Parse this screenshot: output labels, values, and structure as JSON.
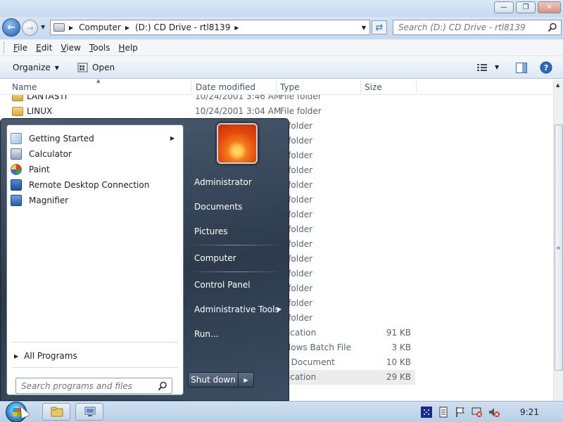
{
  "explorer": {
    "address": {
      "crumbs": [
        "Computer",
        "(D:) CD Drive - rtl8139"
      ]
    },
    "search_placeholder": "Search (D:) CD Drive - rtl8139",
    "menu": [
      "File",
      "Edit",
      "View",
      "Tools",
      "Help"
    ],
    "toolbar": {
      "organize": "Organize",
      "open": "Open"
    },
    "columns": {
      "name": "Name",
      "date": "Date modified",
      "type": "Type",
      "size": "Size"
    },
    "rows": [
      {
        "name": "LANTASTI",
        "date": "10/24/2001 3:46 AM",
        "type": "File folder",
        "size": ""
      },
      {
        "name": "LINUX",
        "date": "10/24/2001 3:04 AM",
        "type": "File folder",
        "size": ""
      },
      {
        "name": "",
        "date": "",
        "type": "e folder",
        "size": ""
      },
      {
        "name": "",
        "date": "",
        "type": "e folder",
        "size": ""
      },
      {
        "name": "",
        "date": "",
        "type": "e folder",
        "size": ""
      },
      {
        "name": "",
        "date": "",
        "type": "e folder",
        "size": ""
      },
      {
        "name": "",
        "date": "",
        "type": "e folder",
        "size": ""
      },
      {
        "name": "",
        "date": "",
        "type": "e folder",
        "size": ""
      },
      {
        "name": "",
        "date": "",
        "type": "e folder",
        "size": ""
      },
      {
        "name": "",
        "date": "",
        "type": "e folder",
        "size": ""
      },
      {
        "name": "",
        "date": "",
        "type": "e folder",
        "size": ""
      },
      {
        "name": "",
        "date": "",
        "type": "e folder",
        "size": ""
      },
      {
        "name": "",
        "date": "",
        "type": "e folder",
        "size": ""
      },
      {
        "name": "",
        "date": "",
        "type": "e folder",
        "size": ""
      },
      {
        "name": "",
        "date": "",
        "type": "e folder",
        "size": ""
      },
      {
        "name": "",
        "date": "",
        "type": "e folder",
        "size": ""
      },
      {
        "name": "",
        "date": "",
        "type": "plication",
        "size": "91 KB"
      },
      {
        "name": "",
        "date": "",
        "type": "ndows Batch File",
        "size": "3 KB"
      },
      {
        "name": "",
        "date": "",
        "type": "xt Document",
        "size": "10 KB"
      },
      {
        "name": "",
        "date": "",
        "type": "plication",
        "size": "29 KB"
      }
    ]
  },
  "start_menu": {
    "programs": [
      {
        "label": "Getting Started",
        "icon": "getting-started-icon"
      },
      {
        "label": "Calculator",
        "icon": "calculator-icon"
      },
      {
        "label": "Paint",
        "icon": "paint-icon"
      },
      {
        "label": "Remote Desktop Connection",
        "icon": "remote-desktop-icon"
      },
      {
        "label": "Magnifier",
        "icon": "magnifier-icon"
      }
    ],
    "all_programs": "All Programs",
    "search_placeholder": "Search programs and files",
    "right_items": [
      "Administrator",
      "Documents",
      "Pictures",
      "Computer",
      "Control Panel",
      "Administrative Tools",
      "Run..."
    ],
    "shutdown": "Shut down"
  },
  "taskbar": {
    "clock": "9:21"
  }
}
